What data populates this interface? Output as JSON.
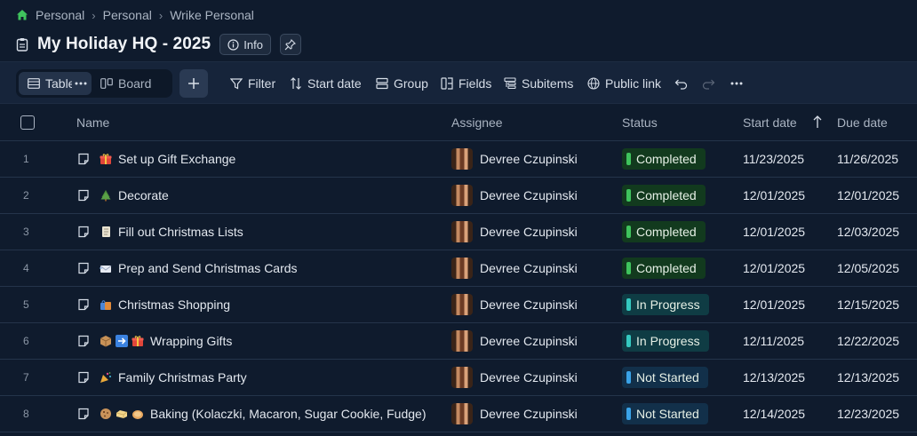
{
  "breadcrumb": [
    "Personal",
    "Personal",
    "Wrike Personal"
  ],
  "title": "My Holiday HQ - 2025",
  "info_label": "Info",
  "views": {
    "table": "Table",
    "board": "Board"
  },
  "toolbar": {
    "filter": "Filter",
    "sort": "Start date",
    "group": "Group",
    "fields": "Fields",
    "subitems": "Subitems",
    "public_link": "Public link"
  },
  "columns": {
    "name": "Name",
    "assignee": "Assignee",
    "status": "Status",
    "start": "Start date",
    "due": "Due date"
  },
  "rows": [
    {
      "num": "1",
      "name": "Set up Gift Exchange",
      "icons": [
        "gift-icon"
      ],
      "assignee": "Devree Czupinski",
      "status": "Completed",
      "start": "11/23/2025",
      "due": "11/26/2025"
    },
    {
      "num": "2",
      "name": "Decorate",
      "icons": [
        "tree-icon"
      ],
      "assignee": "Devree Czupinski",
      "status": "Completed",
      "start": "12/01/2025",
      "due": "12/01/2025"
    },
    {
      "num": "3",
      "name": "Fill out Christmas Lists",
      "icons": [
        "scroll-icon"
      ],
      "assignee": "Devree Czupinski",
      "status": "Completed",
      "start": "12/01/2025",
      "due": "12/03/2025"
    },
    {
      "num": "4",
      "name": "Prep and Send Christmas Cards",
      "icons": [
        "envelope-icon"
      ],
      "assignee": "Devree Czupinski",
      "status": "Completed",
      "start": "12/01/2025",
      "due": "12/05/2025"
    },
    {
      "num": "5",
      "name": "Christmas Shopping",
      "icons": [
        "shopping-bags-icon"
      ],
      "assignee": "Devree Czupinski",
      "status": "In Progress",
      "start": "12/01/2025",
      "due": "12/15/2025"
    },
    {
      "num": "6",
      "name": "Wrapping Gifts",
      "icons": [
        "package-icon",
        "arrow-right-icon",
        "gift-icon"
      ],
      "assignee": "Devree Czupinski",
      "status": "In Progress",
      "start": "12/11/2025",
      "due": "12/22/2025"
    },
    {
      "num": "7",
      "name": "Family Christmas Party",
      "icons": [
        "party-popper-icon"
      ],
      "assignee": "Devree Czupinski",
      "status": "Not Started",
      "start": "12/13/2025",
      "due": "12/13/2025"
    },
    {
      "num": "8",
      "name": "Baking (Kolaczki, Macaron, Sugar Cookie, Fudge)",
      "icons": [
        "cookie-icon",
        "butter-icon",
        "bread-icon"
      ],
      "assignee": "Devree Czupinski",
      "status": "Not Started",
      "start": "12/14/2025",
      "due": "12/23/2025"
    }
  ],
  "colors": {
    "background": "#0f1b2d",
    "completed": "#3fc35d",
    "in_progress": "#35c9c0",
    "not_started": "#3aa3e8"
  }
}
